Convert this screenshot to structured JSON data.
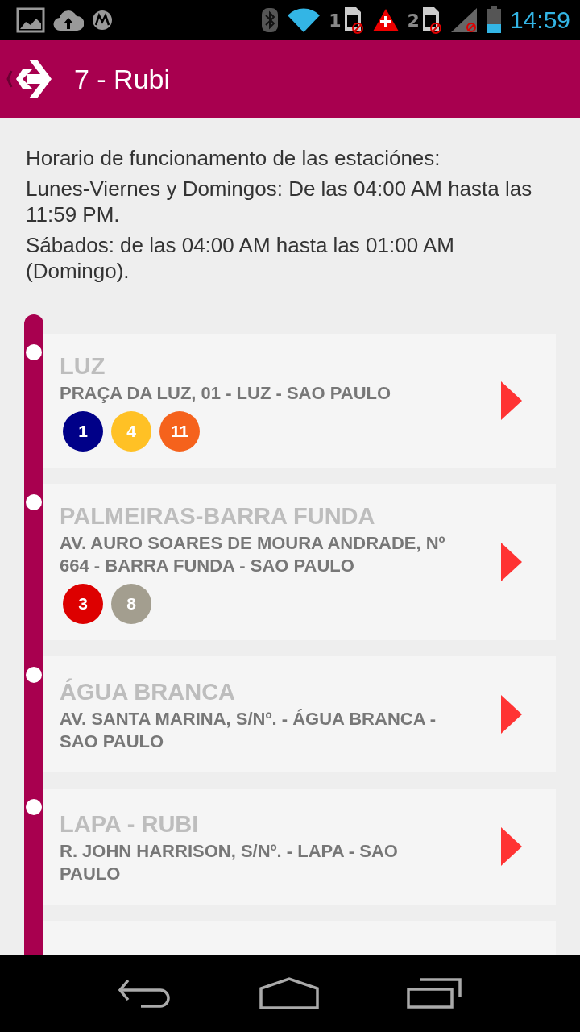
{
  "status_bar": {
    "sim_1": "1",
    "sim_2": "2",
    "time": "14:59"
  },
  "header": {
    "title": "7 - Rubi"
  },
  "schedule": [
    "Horario de funcionamento de las estaciónes:",
    "Lunes-Viernes y Domingos: De las 04:00 AM hasta las 11:59 PM.",
    "Sábados: de las 04:00 AM hasta las 01:00 AM (Domingo)."
  ],
  "stations": [
    {
      "name": "LUZ",
      "address": "PRAÇA DA LUZ, 01 - LUZ - SAO PAULO",
      "lines": [
        {
          "label": "1",
          "color": "#000088"
        },
        {
          "label": "4",
          "color": "#ffc125"
        },
        {
          "label": "11",
          "color": "#f5621c"
        }
      ]
    },
    {
      "name": "PALMEIRAS-BARRA FUNDA",
      "address": "AV. AURO SOARES DE MOURA ANDRADE, Nº 664 - BARRA FUNDA - SAO PAULO",
      "lines": [
        {
          "label": "3",
          "color": "#dd0000"
        },
        {
          "label": "8",
          "color": "#a39e8f"
        }
      ]
    },
    {
      "name": "ÁGUA BRANCA",
      "address": "AV. SANTA MARINA, S/Nº. - ÁGUA BRANCA - SAO PAULO"
    },
    {
      "name": "LAPA - RUBI",
      "address": "R. JOHN HARRISON, S/Nº. - LAPA - SAO PAULO"
    }
  ]
}
